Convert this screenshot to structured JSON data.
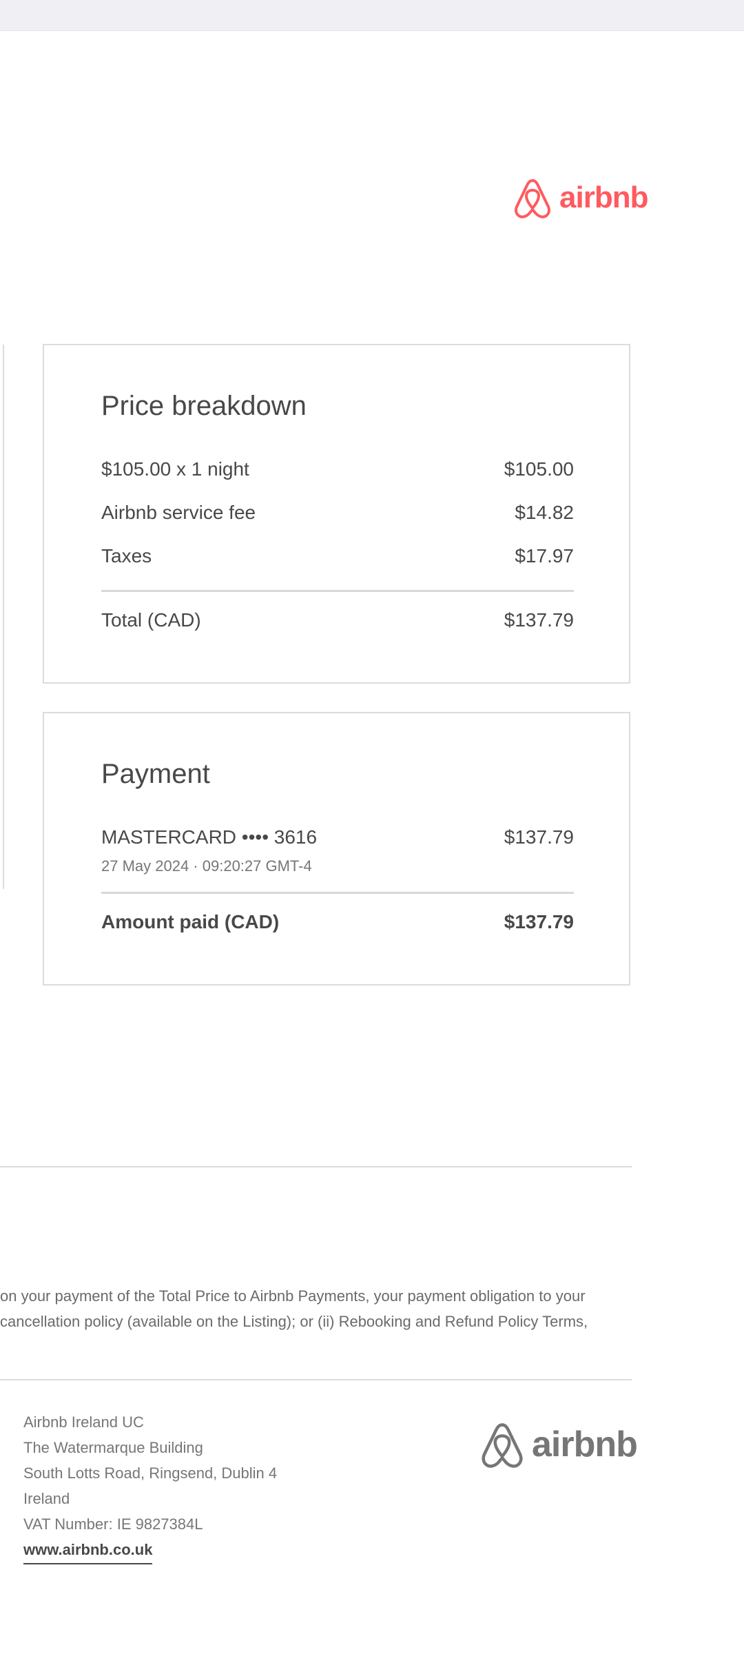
{
  "header": {
    "logo_text": "airbnb",
    "brand_color": "#ff5a5f"
  },
  "price_breakdown": {
    "title": "Price breakdown",
    "rows": [
      {
        "label": "$105.00 x 1 night",
        "amount": "$105.00"
      },
      {
        "label": "Airbnb service fee",
        "amount": "$14.82"
      },
      {
        "label": "Taxes",
        "amount": "$17.97"
      }
    ],
    "total": {
      "label": "Total (CAD)",
      "amount": "$137.79"
    }
  },
  "payment": {
    "title": "Payment",
    "method": {
      "label": "MASTERCARD •••• 3616",
      "amount": "$137.79",
      "date": "27 May 2024 · 09:20:27 GMT-4"
    },
    "amount_paid": {
      "label": "Amount paid (CAD)",
      "amount": "$137.79"
    }
  },
  "terms": {
    "line1": "on your payment of the Total Price to Airbnb Payments, your payment obligation to your",
    "line2": "cancellation policy (available on the Listing); or (ii) Rebooking and Refund Policy Terms,"
  },
  "footer": {
    "company": "Airbnb Ireland UC",
    "address_line1": "The Watermarque Building",
    "address_line2": "South Lotts Road, Ringsend, Dublin 4",
    "country": "Ireland",
    "vat": "VAT Number: IE 9827384L",
    "website": "www.airbnb.co.uk",
    "logo_text": "airbnb",
    "logo_color": "#767676"
  }
}
